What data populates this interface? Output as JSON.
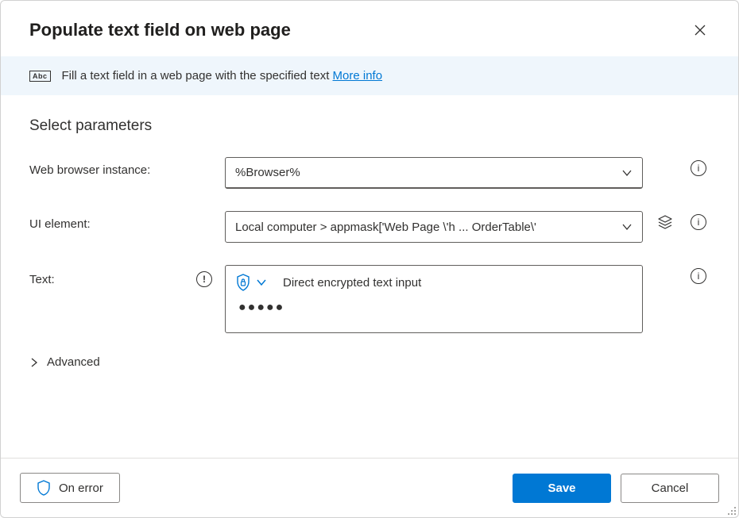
{
  "header": {
    "title": "Populate text field on web page"
  },
  "info_bar": {
    "description": "Fill a text field in a web page with the specified text ",
    "link_text": "More info"
  },
  "parameters": {
    "section_title": "Select parameters",
    "browser": {
      "label": "Web browser instance:",
      "value": "%Browser%"
    },
    "ui_element": {
      "label": "UI element:",
      "value": "Local computer > appmask['Web Page \\'h ... OrderTable\\'"
    },
    "text": {
      "label": "Text:",
      "mode": "Direct encrypted text input",
      "masked_value": "●●●●●"
    },
    "advanced_label": "Advanced"
  },
  "footer": {
    "on_error_label": "On error",
    "save_label": "Save",
    "cancel_label": "Cancel"
  }
}
